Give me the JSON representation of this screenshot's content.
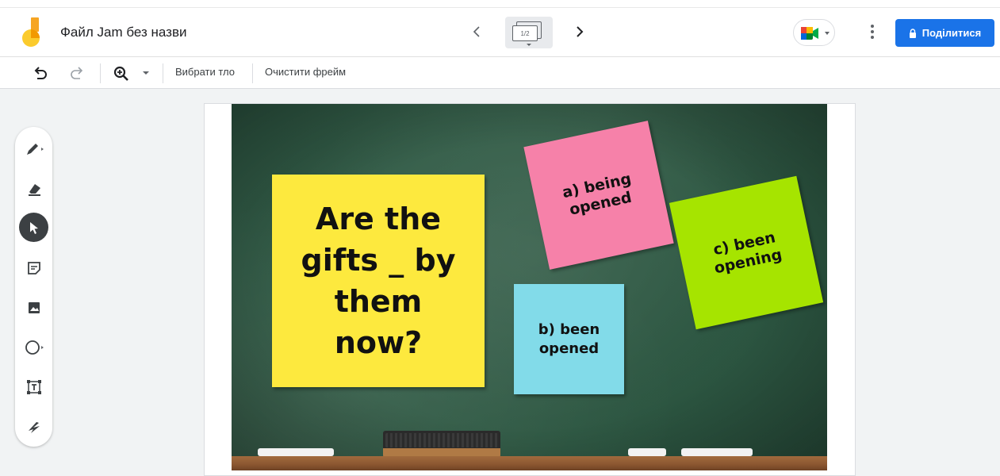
{
  "header": {
    "doc_title": "Файл Jam без назви",
    "frame_indicator": "1/2",
    "share_label": "Поділитися",
    "brand_colors": {
      "logo_orange": "#f6a523",
      "logo_yellow": "#fbcb2d",
      "share_blue": "#1a73e8"
    }
  },
  "toolbar": {
    "choose_background": "Вибрати тло",
    "clear_frame": "Очистити фрейм"
  },
  "tools": [
    {
      "name": "pen",
      "icon": "pen-icon",
      "active": false
    },
    {
      "name": "eraser",
      "icon": "eraser-icon",
      "active": false
    },
    {
      "name": "select",
      "icon": "cursor-icon",
      "active": true
    },
    {
      "name": "sticky-note",
      "icon": "sticky-note-icon",
      "active": false
    },
    {
      "name": "image",
      "icon": "image-icon",
      "active": false
    },
    {
      "name": "shape",
      "icon": "circle-icon",
      "active": false
    },
    {
      "name": "text-box",
      "icon": "text-box-icon",
      "active": false
    },
    {
      "name": "laser",
      "icon": "laser-icon",
      "active": false
    }
  ],
  "board": {
    "notes": {
      "question": "Are the\ngifts _ by\nthem\nnow?",
      "a": "a)    being\nopened",
      "b": "b)    been\nopened",
      "c": "c)    been\nopening"
    },
    "note_colors": {
      "question": "#fde93e",
      "a": "#f681a9",
      "b": "#82dbe9",
      "c": "#a6e400"
    }
  }
}
